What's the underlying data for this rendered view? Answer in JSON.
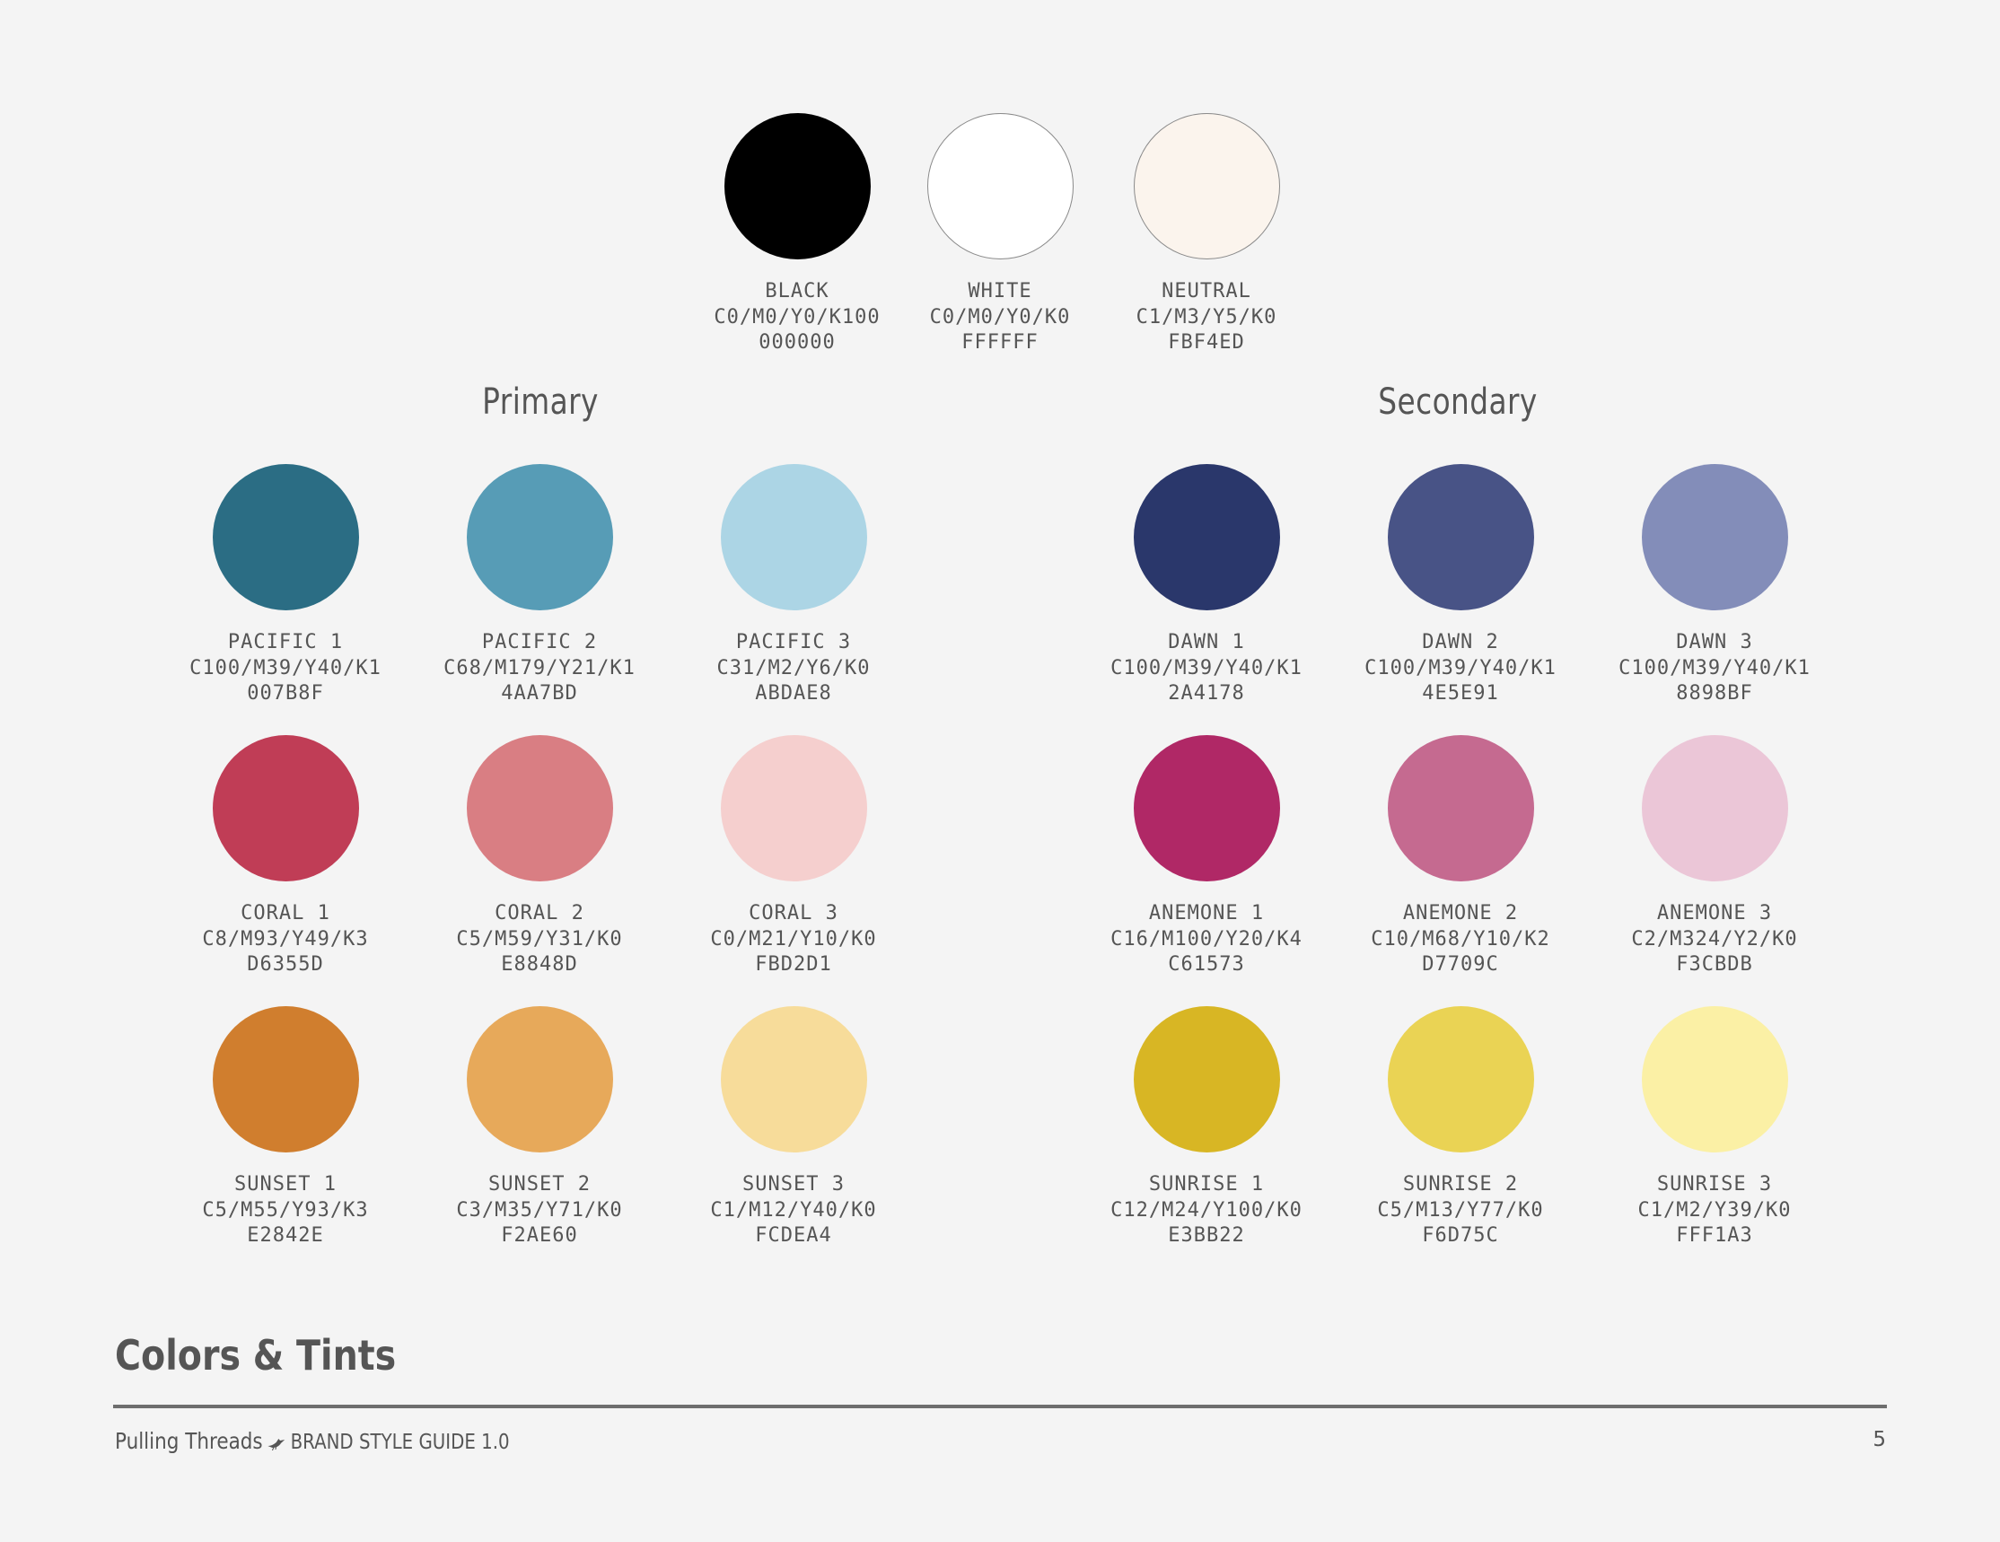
{
  "neutrals": [
    {
      "name": "BLACK",
      "cmyk": "C0/M0/Y0/K100",
      "hex": "000000",
      "color": "#000000",
      "outlined": false
    },
    {
      "name": "WHITE",
      "cmyk": "C0/M0/Y0/K0",
      "hex": "FFFFFF",
      "color": "#FFFFFF",
      "outlined": true
    },
    {
      "name": "NEUTRAL",
      "cmyk": "C1/M3/Y5/K0",
      "hex": "FBF4ED",
      "color": "#FBF4ED",
      "outlined": true
    }
  ],
  "primary": {
    "title": "Primary",
    "rows": [
      [
        {
          "name": "PACIFIC 1",
          "cmyk": "C100/M39/Y40/K1",
          "hex": "007B8F",
          "color": "#2B6D84"
        },
        {
          "name": "PACIFIC 2",
          "cmyk": "C68/M179/Y21/K1",
          "hex": "4AA7BD",
          "color": "#579CB6"
        },
        {
          "name": "PACIFIC 3",
          "cmyk": "C31/M2/Y6/K0",
          "hex": "ABDAE8",
          "color": "#ACD5E5"
        }
      ],
      [
        {
          "name": "CORAL 1",
          "cmyk": "C8/M93/Y49/K3",
          "hex": "D6355D",
          "color": "#C03D56"
        },
        {
          "name": "CORAL 2",
          "cmyk": "C5/M59/Y31/K0",
          "hex": "E8848D",
          "color": "#D97E83"
        },
        {
          "name": "CORAL 3",
          "cmyk": "C0/M21/Y10/K0",
          "hex": "FBD2D1",
          "color": "#F5CFCE"
        }
      ],
      [
        {
          "name": "SUNSET 1",
          "cmyk": "C5/M55/Y93/K3",
          "hex": "E2842E",
          "color": "#D07E2E"
        },
        {
          "name": "SUNSET 2",
          "cmyk": "C3/M35/Y71/K0",
          "hex": "F2AE60",
          "color": "#E7A95A"
        },
        {
          "name": "SUNSET 3",
          "cmyk": "C1/M12/Y40/K0",
          "hex": "FCDEA4",
          "color": "#F7DC9A"
        }
      ]
    ]
  },
  "secondary": {
    "title": "Secondary",
    "rows": [
      [
        {
          "name": "DAWN 1",
          "cmyk": "C100/M39/Y40/K1",
          "hex": "2A4178",
          "color": "#2A376B"
        },
        {
          "name": "DAWN 2",
          "cmyk": "C100/M39/Y40/K1",
          "hex": "4E5E91",
          "color": "#485386"
        },
        {
          "name": "DAWN 3",
          "cmyk": "C100/M39/Y40/K1",
          "hex": "8898BF",
          "color": "#838DB9"
        }
      ],
      [
        {
          "name": "ANEMONE 1",
          "cmyk": "C16/M100/Y20/K4",
          "hex": "C61573",
          "color": "#B02866"
        },
        {
          "name": "ANEMONE 2",
          "cmyk": "C10/M68/Y10/K2",
          "hex": "D7709C",
          "color": "#C56A90"
        },
        {
          "name": "ANEMONE 3",
          "cmyk": "C2/M324/Y2/K0",
          "hex": "F3CBDB",
          "color": "#EBC6D7"
        }
      ],
      [
        {
          "name": "SUNRISE 1",
          "cmyk": "C12/M24/Y100/K0",
          "hex": "E3BB22",
          "color": "#D8B624"
        },
        {
          "name": "SUNRISE 2",
          "cmyk": "C5/M13/Y77/K0",
          "hex": "F6D75C",
          "color": "#EAD354"
        },
        {
          "name": "SUNRISE 3",
          "cmyk": "C1/M2/Y39/K0",
          "hex": "FFF1A3",
          "color": "#FBF0A5"
        }
      ]
    ]
  },
  "page_heading": "Colors & Tints",
  "footer": {
    "brand": "Pulling Threads",
    "subtitle": "BRAND STYLE GUIDE 1.0",
    "icon": "bird-icon",
    "page_number": "5"
  }
}
